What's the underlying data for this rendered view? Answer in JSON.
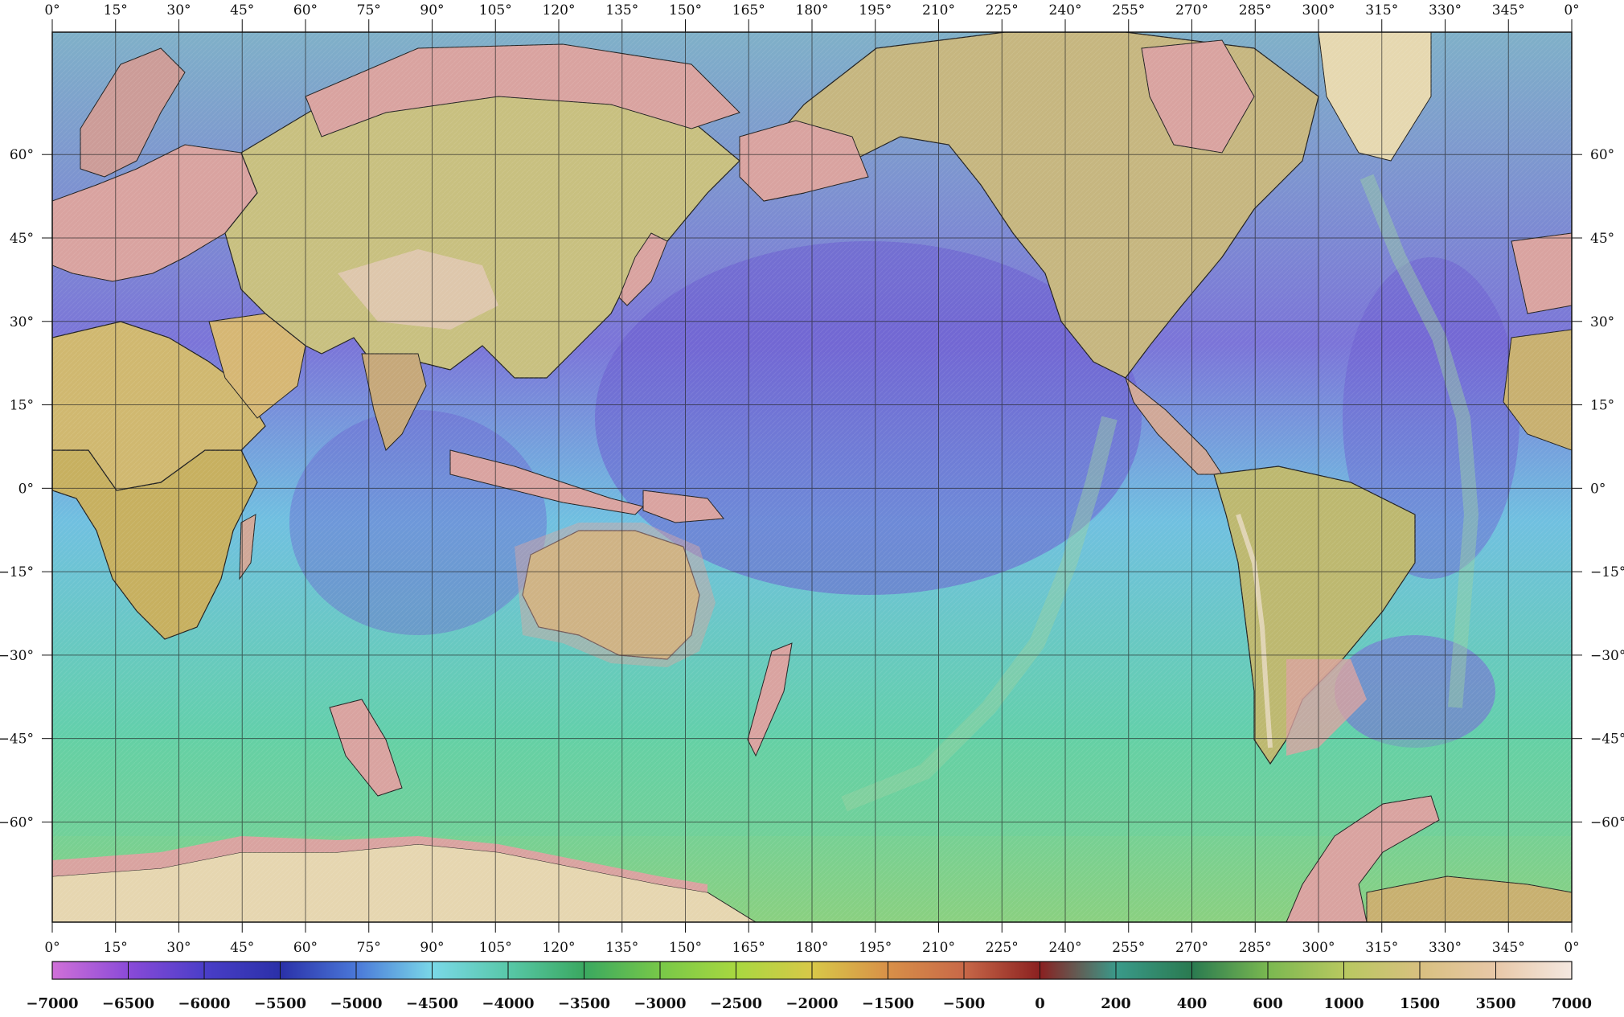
{
  "map": {
    "projection": "equirectangular",
    "lon_range": [
      0,
      360
    ],
    "lat_range": [
      -78,
      82
    ],
    "graticule_step_deg": 15,
    "frame_ticks_top": [
      "0°",
      "15°",
      "30°",
      "45°",
      "60°",
      "75°",
      "90°",
      "105°",
      "120°",
      "135°",
      "150°",
      "165°",
      "180°",
      "195°",
      "210°",
      "225°",
      "240°",
      "255°",
      "270°",
      "285°",
      "300°",
      "315°",
      "330°",
      "345°",
      "0°"
    ],
    "frame_ticks_bottom": [
      "0°",
      "15°",
      "30°",
      "45°",
      "60°",
      "75°",
      "90°",
      "105°",
      "120°",
      "135°",
      "150°",
      "165°",
      "180°",
      "195°",
      "210°",
      "225°",
      "240°",
      "255°",
      "270°",
      "285°",
      "300°",
      "315°",
      "330°",
      "345°",
      "0°"
    ],
    "lat_ticks": [
      {
        "lat": 60,
        "label": "60°"
      },
      {
        "lat": 45,
        "label": "45°"
      },
      {
        "lat": 30,
        "label": "30°"
      },
      {
        "lat": 15,
        "label": "15°"
      },
      {
        "lat": 0,
        "label": "0°"
      },
      {
        "lat": -15,
        "label": "−15°"
      },
      {
        "lat": -30,
        "label": "−30°"
      },
      {
        "lat": -45,
        "label": "−45°"
      },
      {
        "lat": -60,
        "label": "−60°"
      }
    ],
    "colors": {
      "deep_ocean": "#6a5fd0",
      "ocean": "#56b8c8",
      "shelf": "#7fd07a",
      "land_low": "#d9a3a0",
      "land_high": "#e9d6b0"
    }
  },
  "colorbar": {
    "labels": [
      "−7000",
      "−6500",
      "−6000",
      "−5500",
      "−5000",
      "−4500",
      "−4000",
      "−3500",
      "−3000",
      "−2500",
      "−2000",
      "−1500",
      "−500",
      "0",
      "200",
      "400",
      "600",
      "1000",
      "1500",
      "3500",
      "7000"
    ],
    "colors": [
      "#d070d8",
      "#8a4ad8",
      "#4a3ec8",
      "#2a30a8",
      "#4a78d8",
      "#7ad8e8",
      "#58c8a8",
      "#3aa860",
      "#78c848",
      "#a8d840",
      "#d8c848",
      "#d89048",
      "#c86848",
      "#8a2020",
      "#3a9a8a",
      "#2a7a50",
      "#7ab850",
      "#b8c860",
      "#d8c080",
      "#e8c8a8",
      "#f4e8e0"
    ]
  }
}
